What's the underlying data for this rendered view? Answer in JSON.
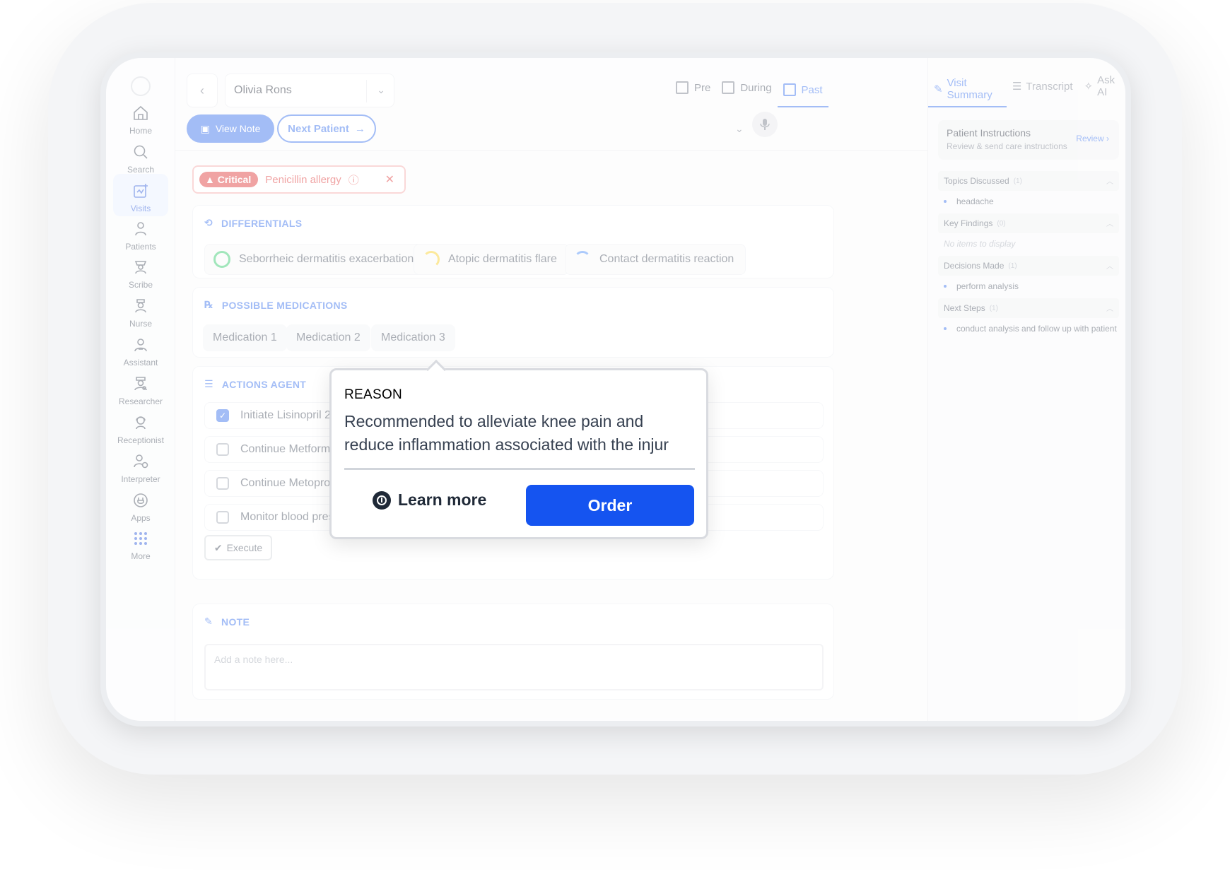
{
  "sidebar": {
    "items": [
      {
        "label": "Home",
        "icon": "home-icon"
      },
      {
        "label": "Search",
        "icon": "search-icon"
      },
      {
        "label": "Visits",
        "icon": "visits-icon",
        "active": true
      },
      {
        "label": "Patients",
        "icon": "patients-icon"
      },
      {
        "label": "Scribe",
        "icon": "scribe-icon"
      },
      {
        "label": "Nurse",
        "icon": "nurse-icon"
      },
      {
        "label": "Assistant",
        "icon": "assistant-icon"
      },
      {
        "label": "Researcher",
        "icon": "researcher-icon"
      },
      {
        "label": "Receptionist",
        "icon": "receptionist-icon"
      },
      {
        "label": "Interpreter",
        "icon": "interpreter-icon"
      },
      {
        "label": "Apps",
        "icon": "apps-icon"
      },
      {
        "label": "More",
        "icon": "grid-icon"
      }
    ]
  },
  "header": {
    "patient_name": "Olivia Rons",
    "phase_tabs": [
      {
        "label": "Pre"
      },
      {
        "label": "During"
      },
      {
        "label": "Past",
        "active": true
      }
    ],
    "view_note_label": "View Note",
    "next_patient_label": "Next Patient"
  },
  "alert": {
    "severity": "Critical",
    "text": "Penicillin allergy"
  },
  "differentials": {
    "title": "DIFFERENTIALS",
    "items": [
      {
        "label": "Seborrheic dermatitis exacerbation",
        "color": "#22c55e"
      },
      {
        "label": "Atopic dermatitis flare",
        "color": "#facc15"
      },
      {
        "label": "Contact dermatitis reaction",
        "color": "#3b82f6"
      }
    ]
  },
  "medications": {
    "title": "POSSIBLE MEDICATIONS",
    "tabs": [
      "Medication 1",
      "Medication 2",
      "Medication 3"
    ]
  },
  "actions": {
    "title": "ACTIONS AGENT",
    "items": [
      {
        "label": "Initiate Lisinopril 2",
        "checked": true
      },
      {
        "label": "Continue Metform",
        "checked": false
      },
      {
        "label": "Continue Metopro",
        "checked": false
      },
      {
        "label": "Monitor blood pres",
        "checked": false
      }
    ],
    "execute_label": "Execute"
  },
  "note": {
    "title": "NOTE",
    "placeholder": "Add a note here..."
  },
  "right_panel": {
    "tabs": [
      {
        "label": "Visit Summary",
        "active": true
      },
      {
        "label": "Transcript"
      },
      {
        "label": "Ask AI"
      }
    ],
    "patient_instructions": {
      "title": "Patient Instructions",
      "subtitle": "Review & send care instructions",
      "action": "Review"
    },
    "sections": [
      {
        "title": "Topics Discussed",
        "count": "(1)",
        "items": [
          "headache"
        ]
      },
      {
        "title": "Key Findings",
        "count": "(0)",
        "empty": "No items to display"
      },
      {
        "title": "Decisions Made",
        "count": "(1)",
        "items": [
          "perform analysis"
        ]
      },
      {
        "title": "Next Steps",
        "count": "(1)",
        "items": [
          "conduct analysis and follow up with patient"
        ]
      }
    ]
  },
  "popover": {
    "label": "REASON",
    "line1": "Recommended to alleviate knee pain and",
    "line2": "reduce inflammation associated with the injur",
    "learn_more_label": "Learn more",
    "order_label": "Order",
    "accent": "#1554f0"
  }
}
